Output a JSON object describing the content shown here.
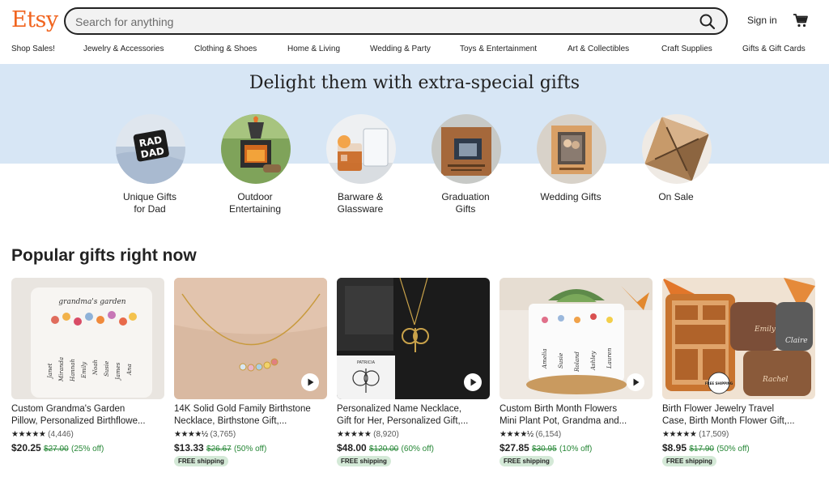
{
  "header": {
    "logo": "Etsy",
    "search_placeholder": "Search for anything",
    "sign_in": "Sign in"
  },
  "nav": [
    "Shop Sales!",
    "Jewelry & Accessories",
    "Clothing & Shoes",
    "Home & Living",
    "Wedding & Party",
    "Toys & Entertainment",
    "Art & Collectibles",
    "Craft Supplies",
    "Gifts & Gift Cards"
  ],
  "hero": {
    "title": "Delight them with extra-special gifts",
    "categories": [
      {
        "line1": "Unique Gifts",
        "line2": "for Dad"
      },
      {
        "line1": "Outdoor",
        "line2": "Entertaining"
      },
      {
        "line1": "Barware &",
        "line2": "Glassware"
      },
      {
        "line1": "Graduation",
        "line2": "Gifts"
      },
      {
        "line1": "Wedding Gifts",
        "line2": ""
      },
      {
        "line1": "On Sale",
        "line2": ""
      }
    ],
    "rad_dad_text_1": "RAD",
    "rad_dad_text_2": "DAD"
  },
  "popular": {
    "title": "Popular gifts right now",
    "products": [
      {
        "line1": "Custom Grandma's Garden",
        "line2": "Pillow, Personalized Birthflowe...",
        "stars": "★★★★★",
        "count": "(4,446)",
        "price": "$20.25",
        "was": "$27.00",
        "off": "(25% off)",
        "shipping": ""
      },
      {
        "line1": "14K Solid Gold Family Birthstone",
        "line2": "Necklace, Birthstone Gift,...",
        "stars": "★★★★½",
        "count": "(3,765)",
        "price": "$13.33",
        "was": "$26.67",
        "off": "(50% off)",
        "shipping": "FREE shipping"
      },
      {
        "line1": "Personalized Name Necklace,",
        "line2": "Gift for Her, Personalized Gift,...",
        "stars": "★★★★★",
        "count": "(8,920)",
        "price": "$48.00",
        "was": "$120.00",
        "off": "(60% off)",
        "shipping": "FREE shipping"
      },
      {
        "line1": "Custom Birth Month Flowers",
        "line2": "Mini Plant Pot, Grandma and...",
        "stars": "★★★★½",
        "count": "(6,154)",
        "price": "$27.85",
        "was": "$30.95",
        "off": "(10% off)",
        "shipping": "FREE shipping"
      },
      {
        "line1": "Birth Flower Jewelry Travel",
        "line2": "Case, Birth Month Flower Gift,...",
        "stars": "★★★★★",
        "count": "(17,509)",
        "price": "$8.95",
        "was": "$17.90",
        "off": "(50% off)",
        "shipping": "FREE shipping"
      }
    ],
    "pillow_text": "grandma's garden",
    "pillow_names": [
      "Janet",
      "Miranda",
      "Hannah",
      "Emily",
      "Noah",
      "Susie",
      "James",
      "Ana"
    ],
    "pot_names": [
      "Amelia",
      "Susie",
      "Roland",
      "Ashley",
      "Lauren"
    ],
    "case_names": [
      "Emily",
      "Claire",
      "Rachel"
    ],
    "necklace_tag": "PATRICIA",
    "free_ship_badge": "FREE SHIPPING"
  },
  "colors": {
    "brand": "#f1641e",
    "hero_band": "#d7e6f5",
    "sale_green": "#258635",
    "ship_badge": "#d4e9d7"
  }
}
